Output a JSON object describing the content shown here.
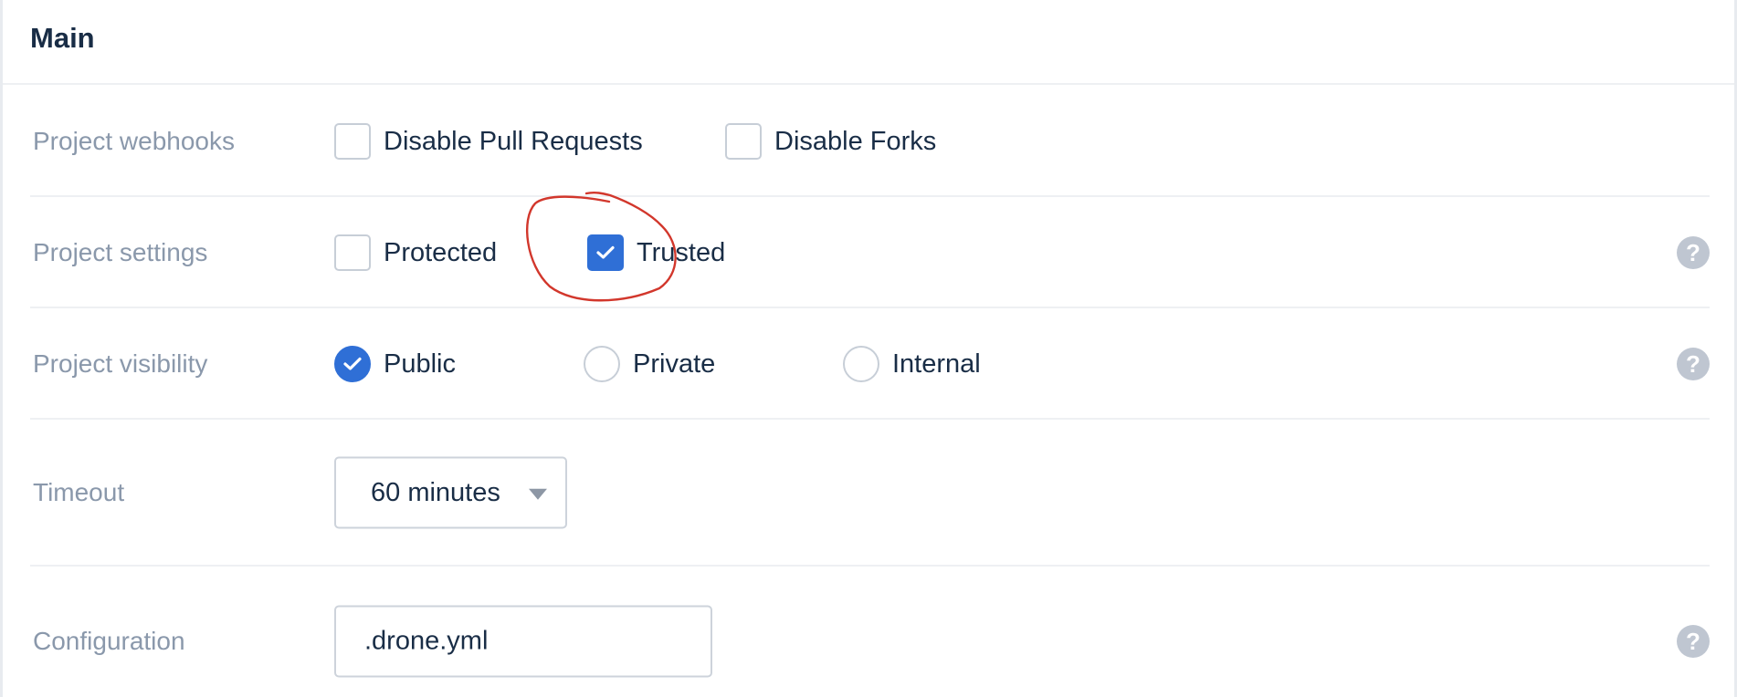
{
  "section": {
    "title": "Main"
  },
  "webhooks": {
    "label": "Project webhooks",
    "options": [
      {
        "label": "Disable Pull Requests",
        "checked": false
      },
      {
        "label": "Disable Forks",
        "checked": false
      }
    ]
  },
  "settings": {
    "label": "Project settings",
    "options": [
      {
        "label": "Protected",
        "checked": false
      },
      {
        "label": "Trusted",
        "checked": true
      }
    ],
    "help": "?"
  },
  "visibility": {
    "label": "Project visibility",
    "options": [
      {
        "label": "Public",
        "selected": true
      },
      {
        "label": "Private",
        "selected": false
      },
      {
        "label": "Internal",
        "selected": false
      }
    ],
    "help": "?"
  },
  "timeout": {
    "label": "Timeout",
    "value": "60 minutes"
  },
  "configuration": {
    "label": "Configuration",
    "value": ".drone.yml",
    "help": "?"
  },
  "colors": {
    "accent": "#2f6fd6",
    "annotation": "#d2372c"
  }
}
